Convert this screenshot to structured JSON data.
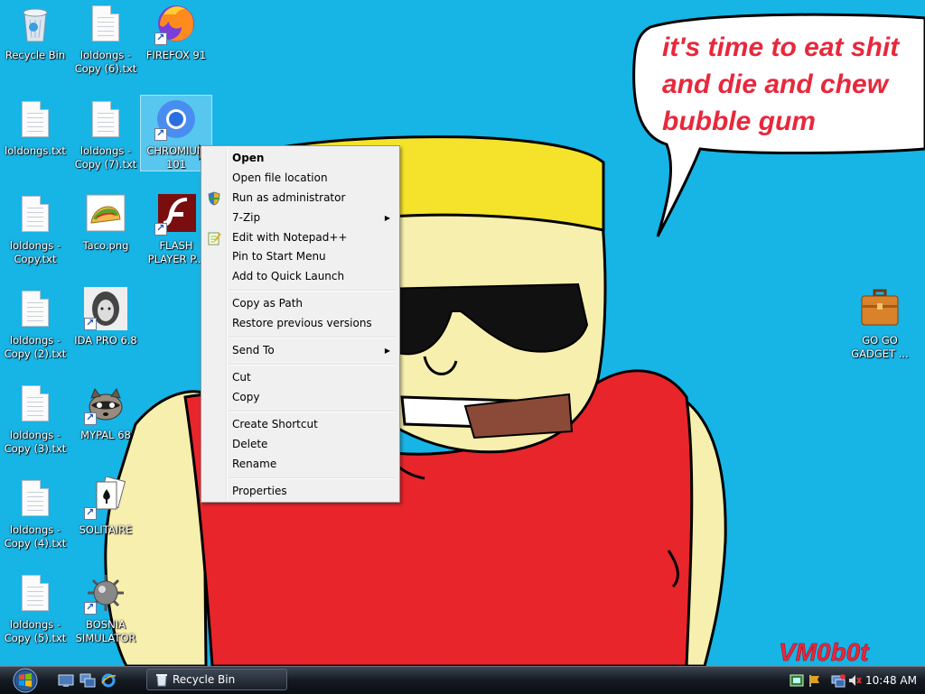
{
  "desktop": {
    "icons": [
      {
        "name": "Recycle Bin",
        "label": "Recycle Bin"
      },
      {
        "name": "loldongs copy 6",
        "label": "loldongs - Copy (6).txt"
      },
      {
        "name": "firefox",
        "label": "FIREFOX 91"
      },
      {
        "name": "loldongs",
        "label": "loldongs.txt"
      },
      {
        "name": "loldongs copy 7",
        "label": "loldongs - Copy (7).txt"
      },
      {
        "name": "chromium",
        "label": "CHROMIUM 101"
      },
      {
        "name": "loldongs copy",
        "label": "loldongs - Copy.txt"
      },
      {
        "name": "taco",
        "label": "Taco.png"
      },
      {
        "name": "flash",
        "label": "FLASH PLAYER P..."
      },
      {
        "name": "loldongs copy 2",
        "label": "loldongs - Copy (2).txt"
      },
      {
        "name": "ida",
        "label": "IDA PRO 6.8"
      },
      {
        "name": "loldongs copy 3",
        "label": "loldongs - Copy (3).txt"
      },
      {
        "name": "mypal",
        "label": "MYPAL 68"
      },
      {
        "name": "loldongs copy 4",
        "label": "loldongs - Copy (4).txt"
      },
      {
        "name": "solitaire",
        "label": "SOLITAIRE"
      },
      {
        "name": "loldongs copy 5",
        "label": "loldongs - Copy (5).txt"
      },
      {
        "name": "bosnia",
        "label": "BOSNIA SIMULATOR"
      },
      {
        "name": "gogo",
        "label": "GO GO GADGET ..."
      }
    ],
    "wallpaper_text": {
      "bubble": [
        "it's time to eat shit",
        "and die and chew",
        "bubble gum"
      ],
      "signature": "VM0b0t"
    }
  },
  "context_menu": {
    "items": [
      {
        "label": "Open",
        "bold": true
      },
      {
        "label": "Open file location"
      },
      {
        "label": "Run as administrator",
        "icon": "shield-icon"
      },
      {
        "label": "7-Zip",
        "submenu": true
      },
      {
        "label": "Edit with Notepad++",
        "icon": "notepadpp-icon"
      },
      {
        "label": "Pin to Start Menu"
      },
      {
        "label": "Add to Quick Launch"
      },
      {
        "label": "Copy as Path"
      },
      {
        "label": "Restore previous versions"
      },
      {
        "label": "Send To",
        "submenu": true
      },
      {
        "label": "Cut"
      },
      {
        "label": "Copy"
      },
      {
        "label": "Create Shortcut"
      },
      {
        "label": "Delete"
      },
      {
        "label": "Rename"
      },
      {
        "label": "Properties"
      }
    ]
  },
  "taskbar": {
    "active_task": "Recycle Bin",
    "clock": "10:48 AM"
  },
  "colors": {
    "desktop_bg": "#17b4e6",
    "wallpaper_text": "#e8283c",
    "shirt": "#e8252b",
    "hat": "#f4e32a",
    "skin": "#f7efad"
  }
}
